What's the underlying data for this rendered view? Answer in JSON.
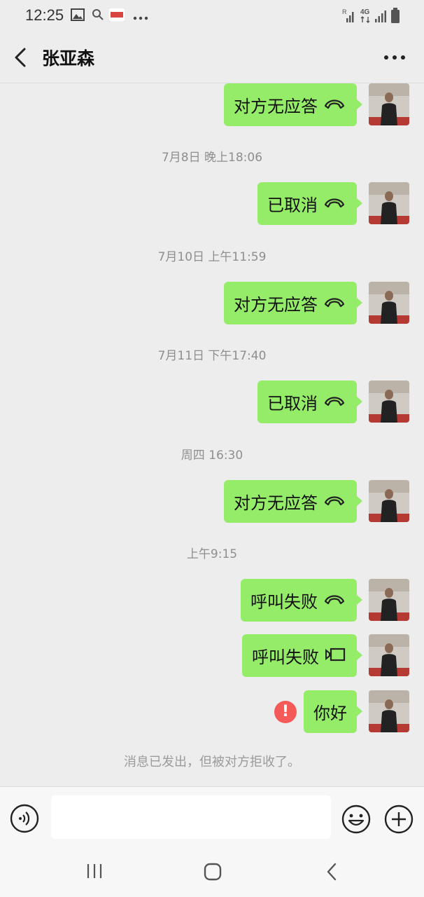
{
  "status_bar": {
    "time": "12:25",
    "icons": [
      "gallery-icon",
      "search-icon",
      "app-badge-icon",
      "more-dots-icon",
      "signal-r-icon",
      "4g-icon",
      "signal-icon",
      "battery-icon"
    ],
    "network_label": "4G"
  },
  "header": {
    "title": "张亚森",
    "back_icon": "chevron-left-icon",
    "more_icon": "more-dots-icon"
  },
  "messages": [
    {
      "type": "call",
      "text": "对方无应答",
      "icon": "phone-hangup-icon"
    },
    {
      "type": "time",
      "text": "7月8日 晚上18:06"
    },
    {
      "type": "call",
      "text": "已取消",
      "icon": "phone-hangup-icon"
    },
    {
      "type": "time",
      "text": "7月10日 上午11:59"
    },
    {
      "type": "call",
      "text": "对方无应答",
      "icon": "phone-hangup-icon"
    },
    {
      "type": "time",
      "text": "7月11日 下午17:40"
    },
    {
      "type": "call",
      "text": "已取消",
      "icon": "phone-hangup-icon"
    },
    {
      "type": "time",
      "text": "周四 16:30"
    },
    {
      "type": "call",
      "text": "对方无应答",
      "icon": "phone-hangup-icon"
    },
    {
      "type": "time",
      "text": "上午9:15"
    },
    {
      "type": "call",
      "text": "呼叫失败",
      "icon": "phone-hangup-icon"
    },
    {
      "type": "call",
      "text": "呼叫失败",
      "icon": "video-call-icon"
    },
    {
      "type": "text",
      "text": "你好",
      "status": "error"
    }
  ],
  "notice": "消息已发出，但被对方拒收了。",
  "input": {
    "value": "",
    "placeholder": "",
    "voice_icon": "voice-icon",
    "emoji_icon": "emoji-icon",
    "plus_icon": "plus-icon"
  },
  "nav": {
    "recents_icon": "recents-icon",
    "home_icon": "home-icon",
    "back_icon": "back-icon"
  },
  "colors": {
    "bubble": "#95ec69",
    "background": "#ededed",
    "error": "#f45a57"
  }
}
